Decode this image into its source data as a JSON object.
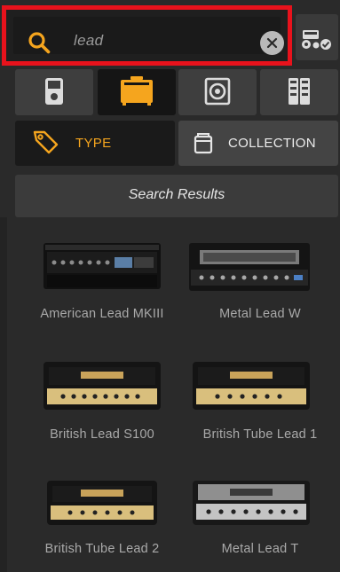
{
  "search": {
    "query": "lead",
    "accent": "#f5a51e",
    "highlight_color": "#e8121c"
  },
  "categories": [
    {
      "name": "stomp",
      "icon": "stompbox-icon",
      "active": false
    },
    {
      "name": "amp",
      "icon": "amp-head-icon",
      "active": true
    },
    {
      "name": "cab",
      "icon": "speaker-cabinet-icon",
      "active": false
    },
    {
      "name": "rack",
      "icon": "rack-effects-icon",
      "active": false
    }
  ],
  "filters": {
    "type_label": "TYPE",
    "collection_label": "COLLECTION"
  },
  "results": {
    "title": "Search Results",
    "items": [
      {
        "label": "American Lead MKIII",
        "style": "rack-black"
      },
      {
        "label": "Metal Lead W",
        "style": "metal-black"
      },
      {
        "label": "British Lead S100",
        "style": "british-gold"
      },
      {
        "label": "British Tube Lead 1",
        "style": "british-gold"
      },
      {
        "label": "British Tube Lead 2",
        "style": "british-gold"
      },
      {
        "label": "Metal Lead T",
        "style": "metal-silver"
      }
    ]
  }
}
